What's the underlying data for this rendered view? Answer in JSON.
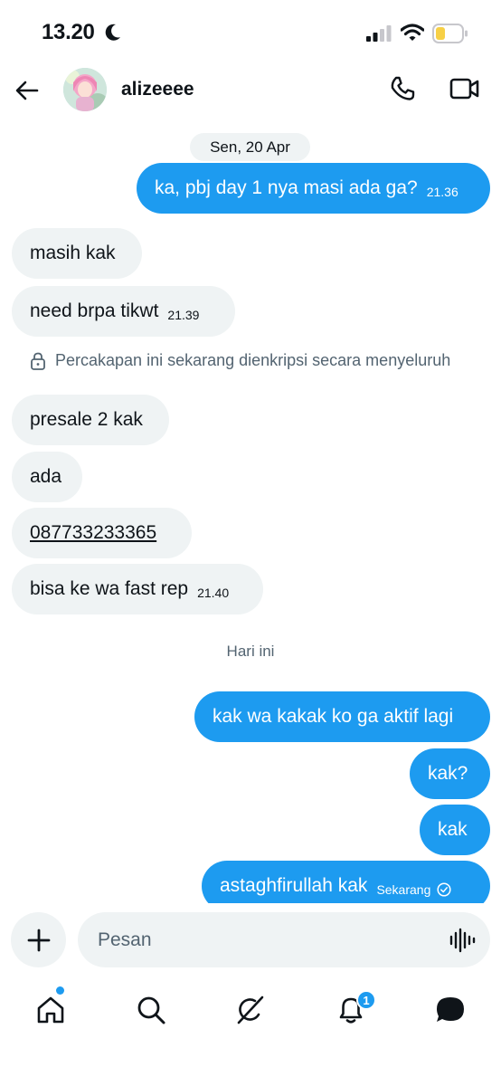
{
  "status_bar": {
    "time": "13.20"
  },
  "header": {
    "contact_name": "alizeeee"
  },
  "conversation": {
    "date_separator_1": "Sen, 20 Apr",
    "date_separator_2": "Hari ini",
    "encryption_notice": "Percakapan ini sekarang dienkripsi secara menyeluruh",
    "messages": [
      {
        "direction": "out",
        "text": "ka, pbj day 1 nya masi ada ga?",
        "time": "21.36"
      },
      {
        "direction": "in",
        "text": "masih kak",
        "time": ""
      },
      {
        "direction": "in",
        "text": "need brpa tikwt",
        "time": "21.39"
      },
      {
        "direction": "in",
        "text": "presale 2 kak",
        "time": ""
      },
      {
        "direction": "in",
        "text": "ada",
        "time": ""
      },
      {
        "direction": "in",
        "text": "087733233365",
        "time": ""
      },
      {
        "direction": "in",
        "text": "bisa ke wa fast rep",
        "time": "21.40"
      },
      {
        "direction": "out",
        "text": "kak wa kakak ko ga aktif lagi",
        "time": ""
      },
      {
        "direction": "out",
        "text": "kak?",
        "time": ""
      },
      {
        "direction": "out",
        "text": "kak",
        "time": ""
      },
      {
        "direction": "out",
        "text": "astaghfirullah kak",
        "time": "Sekarang"
      }
    ]
  },
  "composer": {
    "placeholder": "Pesan"
  },
  "bottom_nav": {
    "notification_count": "1"
  },
  "colors": {
    "accent": "#1d9bf0",
    "incoming_bubble": "#eff3f4",
    "muted_text": "#536471"
  },
  "icons": [
    "moon-icon",
    "signal-icon",
    "wifi-icon",
    "battery-icon",
    "back-arrow-icon",
    "phone-icon",
    "video-camera-icon",
    "lock-icon",
    "check-circle-icon",
    "plus-icon",
    "voice-wave-icon",
    "home-icon",
    "search-icon",
    "grok-icon",
    "bell-icon",
    "messages-icon"
  ]
}
